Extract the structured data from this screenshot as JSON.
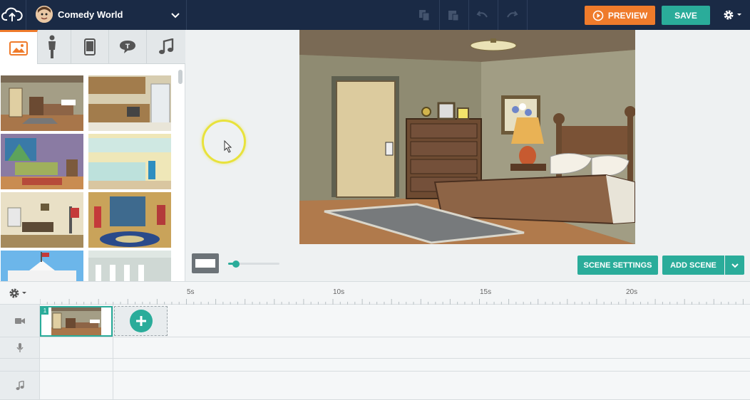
{
  "app": {
    "project_name": "Comedy World"
  },
  "toolbar": {
    "preview_label": "PREVIEW",
    "save_label": "SAVE"
  },
  "library": {
    "tabs": [
      {
        "name": "backgrounds",
        "icon": "image-icon",
        "active": true
      },
      {
        "name": "characters",
        "icon": "person-icon",
        "active": false
      },
      {
        "name": "props",
        "icon": "phone-icon",
        "active": false
      },
      {
        "name": "text",
        "icon": "speech-bubble-icon",
        "active": false
      },
      {
        "name": "audio",
        "icon": "music-note-icon",
        "active": false
      }
    ],
    "thumbnails": [
      "bedroom",
      "kitchen",
      "living-room",
      "office-kitchen",
      "meeting-office",
      "oval-office",
      "white-house",
      "building-exterior"
    ]
  },
  "scene_controls": {
    "scene_settings_label": "SCENE SETTINGS",
    "add_scene_label": "ADD SCENE",
    "zoom_fraction": 0.15
  },
  "timeline": {
    "ruler_labels": [
      "5s",
      "10s",
      "15s",
      "20s"
    ],
    "scene_number": "1",
    "tracks": [
      "camera-track",
      "microphone-track",
      "music-track"
    ]
  },
  "colors": {
    "topbar": "#1a2a45",
    "accent_orange": "#ef7b2b",
    "accent_teal": "#2aac9a"
  }
}
